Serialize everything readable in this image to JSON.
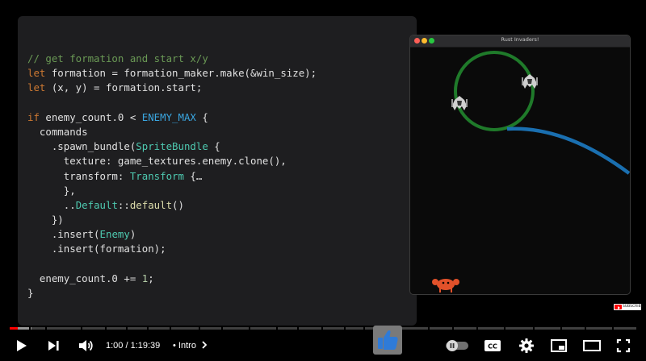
{
  "code": {
    "lines": [
      [
        {
          "t": "// get formation and start x/y",
          "c": "comment"
        }
      ],
      [
        {
          "t": "let ",
          "c": "kw"
        },
        {
          "t": "formation = formation_maker.make(&win_size);",
          "c": "plain"
        }
      ],
      [
        {
          "t": "let ",
          "c": "kw"
        },
        {
          "t": "(x, y) = formation.start;",
          "c": "plain"
        }
      ],
      [],
      [
        {
          "t": "if ",
          "c": "kw"
        },
        {
          "t": "enemy_count.0 < ",
          "c": "plain"
        },
        {
          "t": "ENEMY_MAX",
          "c": "const"
        },
        {
          "t": " {",
          "c": "plain"
        }
      ],
      [
        {
          "t": "  commands",
          "c": "plain"
        }
      ],
      [
        {
          "t": "    .spawn_bundle(",
          "c": "plain"
        },
        {
          "t": "SpriteBundle",
          "c": "type"
        },
        {
          "t": " {",
          "c": "plain"
        }
      ],
      [
        {
          "t": "      texture: game_textures.enemy.clone(),",
          "c": "plain"
        }
      ],
      [
        {
          "t": "      transform: ",
          "c": "plain"
        },
        {
          "t": "Transform",
          "c": "type"
        },
        {
          "t": " {…",
          "c": "plain"
        }
      ],
      [
        {
          "t": "      },",
          "c": "plain"
        }
      ],
      [
        {
          "t": "      ..",
          "c": "plain"
        },
        {
          "t": "Default",
          "c": "type"
        },
        {
          "t": "::",
          "c": "plain"
        },
        {
          "t": "default",
          "c": "fn"
        },
        {
          "t": "()",
          "c": "plain"
        }
      ],
      [
        {
          "t": "    })",
          "c": "plain"
        }
      ],
      [
        {
          "t": "    .insert(",
          "c": "plain"
        },
        {
          "t": "Enemy",
          "c": "type"
        },
        {
          "t": ")",
          "c": "plain"
        }
      ],
      [
        {
          "t": "    .insert(formation);",
          "c": "plain"
        }
      ],
      [],
      [
        {
          "t": "  enemy_count.0 += ",
          "c": "plain"
        },
        {
          "t": "1",
          "c": "num"
        },
        {
          "t": ";",
          "c": "plain"
        }
      ],
      [
        {
          "t": "}",
          "c": "plain"
        }
      ]
    ]
  },
  "game_window": {
    "title": "Rust Invaders!",
    "circle_color": "#1f7a2a",
    "path_color": "#1a6fb0",
    "player_color": "#e2512a"
  },
  "player": {
    "progress_played_fraction": 0.0126,
    "progress_buffered_fraction": 0.035,
    "time": "1:00 / 1:19:39",
    "chapter_separator": "•",
    "chapter": "Intro",
    "accent_color": "#ff0000",
    "icons": [
      "play-icon",
      "next-icon",
      "volume-icon",
      "thumbs-up-icon",
      "autoplay-toggle-icon",
      "captions-icon",
      "settings-icon",
      "miniplayer-icon",
      "theater-mode-icon",
      "fullscreen-icon"
    ],
    "captions_label": "CC",
    "subscribe_label": "SUBSCRIBE"
  }
}
